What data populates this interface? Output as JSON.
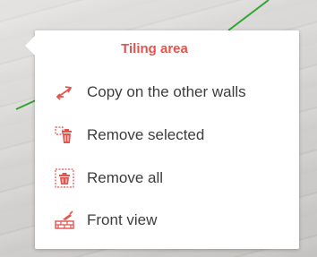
{
  "menu": {
    "title": "Tiling area",
    "accent_color": "#e2544d",
    "items": [
      {
        "icon": "swap-arrows-icon",
        "label": "Copy on the other walls"
      },
      {
        "icon": "trash-icon",
        "label": "Remove selected"
      },
      {
        "icon": "remove-all-icon",
        "label": "Remove all"
      },
      {
        "icon": "tiles-trowel-icon",
        "label": "Front view"
      }
    ]
  }
}
